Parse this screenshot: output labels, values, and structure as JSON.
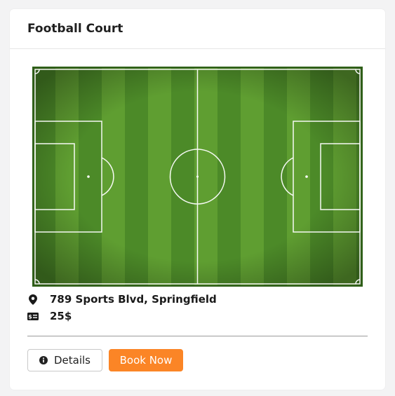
{
  "card": {
    "title": "Football Court"
  },
  "pitch": {
    "image_icon": "football-pitch-image"
  },
  "info": {
    "address": "789 Sports Blvd, Springfield",
    "address_icon": "location-pin-icon",
    "price": "25$",
    "price_icon": "money-bill-icon"
  },
  "actions": {
    "details_label": "Details",
    "details_icon": "info-circle-icon",
    "book_label": "Book Now"
  },
  "colors": {
    "accent": "#fb8526",
    "grass_dark": "#3f7a22",
    "grass_light": "#5b9a30"
  }
}
